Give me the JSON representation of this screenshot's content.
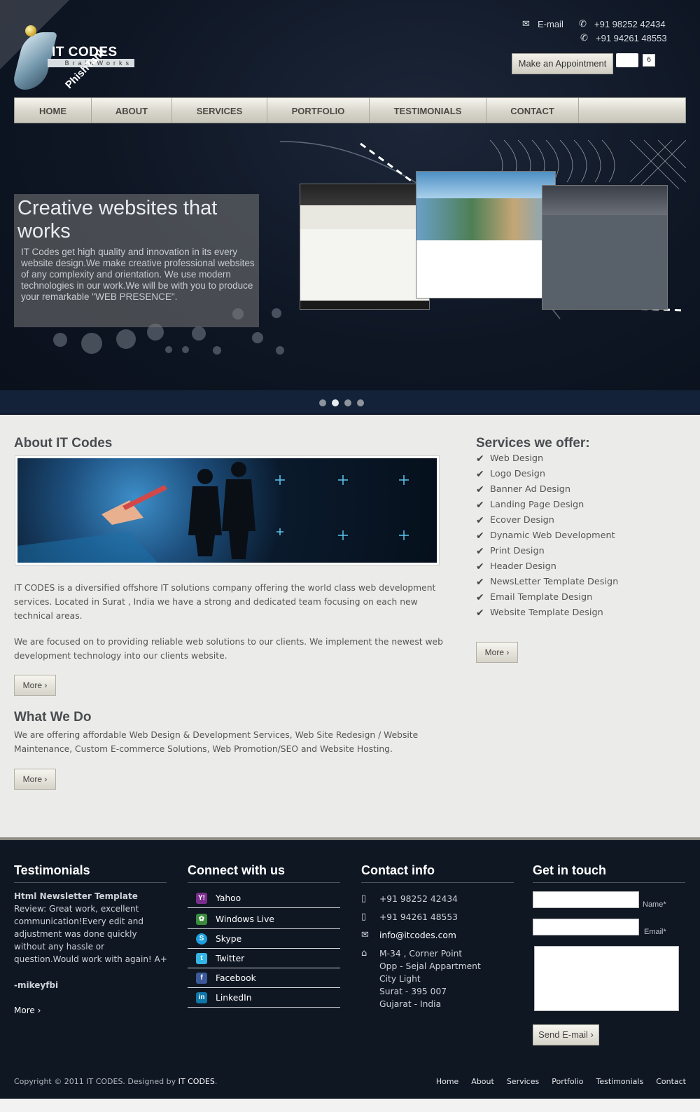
{
  "brand": {
    "name": "IT CODES",
    "tagline": "BrainWorks",
    "badge": "PhishTank"
  },
  "top_contact": {
    "email_label": "E-mail",
    "phone1": "+91 98252 42434",
    "phone2": "+91 94261 48553",
    "appointment_label": "Make an Appointment",
    "like_count": "6"
  },
  "nav": [
    "HOME",
    "ABOUT",
    "SERVICES",
    "PORTFOLIO",
    "TESTIMONIALS",
    "CONTACT"
  ],
  "hero": {
    "title": "Creative websites that works",
    "text": "IT Codes get high quality and innovation in its every website design.We make creative professional websites of any complexity and orientation. We use modern technologies in our work.We will be with you to produce your remarkable \"WEB PRESENCE\".",
    "slides": 4,
    "active_slide": 2
  },
  "about": {
    "heading": "About IT Codes",
    "para1": "IT CODES is a diversified offshore IT solutions company offering the world class web development services. Located in Surat , India we have a strong and dedicated team focusing on each new technical areas.",
    "para2": "We are focused on to providing reliable web solutions to our clients. We implement the newest web development technology into our clients website.",
    "more_label": "More ›"
  },
  "what_we_do": {
    "heading": "What We Do",
    "text": "We are offering affordable Web Design & Development Services, Web Site Redesign / Website Maintenance, Custom E-commerce Solutions, Web Promotion/SEO and Website Hosting.",
    "more_label": "More ›"
  },
  "services": {
    "heading": "Services we offer:",
    "items": [
      "Web Design",
      "Logo Design",
      "Banner Ad Design",
      "Landing Page Design",
      "Ecover Design",
      "Dynamic Web Development",
      "Print Design",
      "Header Design",
      "NewsLetter Template Design",
      "Email Template Design",
      "Website Template Design"
    ],
    "more_label": "More ›"
  },
  "testimonials": {
    "heading": "Testimonials",
    "title": "Html Newsletter Template",
    "review": "Review: Great work, excellent communication!Every edit and adjustment was done quickly without any hassle or question.Would work with again! A+",
    "author": "-mikeyfbi",
    "more_label": "More ›"
  },
  "connect": {
    "heading": "Connect with us",
    "items": [
      {
        "label": "Yahoo",
        "icon": "yahoo-icon",
        "color": "#7b2d8e"
      },
      {
        "label": "Windows Live",
        "icon": "windows-live-icon",
        "color": "#3a8c3c"
      },
      {
        "label": "Skype",
        "icon": "skype-icon",
        "color": "#1ba1e2"
      },
      {
        "label": "Twitter",
        "icon": "twitter-icon",
        "color": "#33b5e5"
      },
      {
        "label": "Facebook",
        "icon": "facebook-icon",
        "color": "#3b5998"
      },
      {
        "label": "LinkedIn",
        "icon": "linkedin-icon",
        "color": "#0e76a8"
      }
    ]
  },
  "contact_info": {
    "heading": "Contact info",
    "phone1": "+91 98252 42434",
    "phone2": "+91 94261 48553",
    "email": "info@itcodes.com",
    "address": [
      "M-34 , Corner Point",
      "Opp - Sejal Appartment",
      "City Light",
      "Surat - 395 007",
      "Gujarat - India"
    ]
  },
  "get_in_touch": {
    "heading": "Get in touch",
    "name_label": "Name*",
    "email_label": "Email*",
    "send_label": "Send E-mail ›"
  },
  "footer": {
    "copyright_prefix": "Copyright © 2011 IT CODES. Designed by ",
    "designer": "IT CODES",
    "copyright_suffix": ".",
    "nav": [
      "Home",
      "About",
      "Services",
      "Portfolio",
      "Testimonials",
      "Contact"
    ]
  }
}
